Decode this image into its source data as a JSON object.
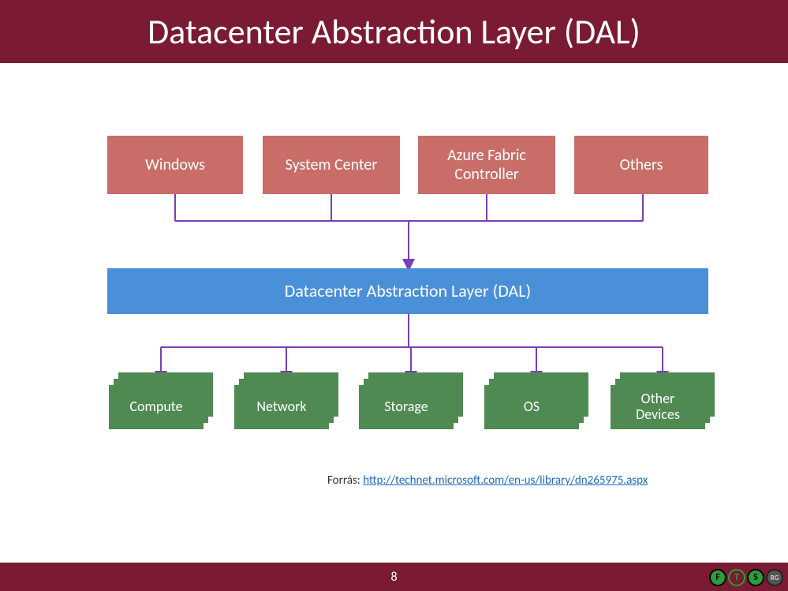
{
  "title": "Datacenter Abstraction Layer (DAL)",
  "top_row": {
    "b1": "Windows",
    "b2": "System Center",
    "b3": "Azure Fabric\nController",
    "b4": "Others"
  },
  "middle": "Datacenter Abstraction Layer (DAL)",
  "bottom_row": {
    "s1": "Compute",
    "s2": "Network",
    "s3": "Storage",
    "s4": "OS",
    "s5": "Other\nDevices"
  },
  "source_label": "Forrás: ",
  "source_url": "http://technet.microsoft.com/en-us/library/dn265975.aspx",
  "page_number": "8",
  "footer_logo_right": {
    "a": "F",
    "b": "T",
    "c": "S",
    "d": "RG"
  },
  "colors": {
    "brand": "#7a1b33",
    "top_box": "#c86d68",
    "mid_box": "#4a90d9",
    "stack": "#4f8a53",
    "arrow": "#7b3fb0"
  }
}
